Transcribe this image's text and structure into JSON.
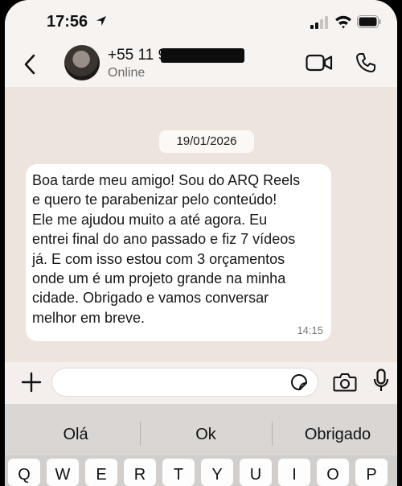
{
  "status_bar": {
    "time": "17:56"
  },
  "header": {
    "contact_number": "+55 11 99",
    "contact_status": "Online"
  },
  "chat": {
    "date": "19/01/2026",
    "message": {
      "text": "Boa tarde meu amigo! Sou do ARQ Reels\ne quero te parabenizar pelo conteúdo!\nEle me ajudou muito a até agora. Eu\nentrei final do ano passado e fiz 7 vídeos\njá. E com isso estou com 3 orçamentos\nonde um é um projeto grande na minha\ncidade. Obrigado e vamos conversar\nmelhor em breve.",
      "time": "14:15"
    }
  },
  "suggestions": [
    "Olá",
    "Ok",
    "Obrigado"
  ],
  "keyboard_row": [
    "Q",
    "W",
    "E",
    "R",
    "T",
    "Y",
    "U",
    "I",
    "O",
    "P"
  ],
  "icons": {
    "status": [
      "location-arrow-icon",
      "signal-icon",
      "wifi-icon",
      "battery-icon"
    ],
    "header": [
      "back-icon",
      "video-call-icon",
      "phone-call-icon"
    ],
    "composer": [
      "plus-icon",
      "sticker-icon",
      "camera-icon",
      "mic-icon"
    ]
  },
  "colors": {
    "chat_background": "#ece4dd",
    "bubble": "#ffffff",
    "keyboard": "#dad6d3"
  }
}
